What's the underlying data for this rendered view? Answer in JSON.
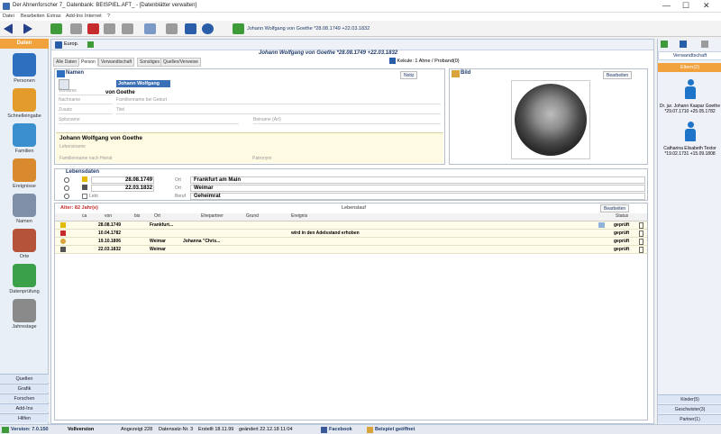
{
  "window": {
    "title": "Der Ahnenforscher 7_ Datenbank: BEISPIEL.AFT_ - [Datenblätter verwalten]",
    "controls": [
      "—",
      "☐",
      "✕"
    ]
  },
  "menu": [
    "Datei",
    "Bearbeiten",
    "Extras",
    "Add-Ins",
    "Internet",
    "?"
  ],
  "subbar": {
    "dropdown": "Europ."
  },
  "person_header": "Johann Wolfgang von Goethe   *28.08.1749  +22.03.1832",
  "kekule": "Kekule: 1  Ahne / Proband(0)",
  "tabs": [
    "Alle Daten",
    "Person",
    "Verwandtschaft",
    "Sonstiges",
    "Quellen/Verweise"
  ],
  "left_panel": {
    "header": "Daten",
    "nav": [
      "Personen",
      "Schnelleingabe",
      "Familien",
      "Ereignisse",
      "Namen",
      "Orte",
      "Datenprüfung",
      "Jahrestage"
    ],
    "bottom": [
      "Quellen",
      "Grafik",
      "Forschen",
      "Add-Ins",
      "Hilfen"
    ]
  },
  "names_box": {
    "title": "Namen",
    "notes_btn": "Notiz",
    "rufname": "Johann Wolfgang",
    "praefix": "von",
    "nachname": "Goethe",
    "placeholders": {
      "vorname": "Vorname",
      "nachname": "Nachname",
      "zusatz": "Familienname bei Geburt",
      "zusatz2": "Zusatz",
      "titel": "Titel",
      "spitz": "Spitzname",
      "beiname": "Beiname (Art)"
    },
    "full_name": "Johann Wolfgang von Goethe",
    "lebensname": "Lebensname",
    "famname_heirat": "Familienname nach Heirat",
    "patronym": "Patronym"
  },
  "bild_box": {
    "title": "Bild",
    "edit_btn": "Bearbeiten"
  },
  "lebensdaten": {
    "title": "Lebensdaten",
    "birth_date": "28.08.1749",
    "birth_place": "Frankfurt am Main",
    "death_date": "22.03.1832",
    "death_place": "Weimar",
    "beruf_label": "Beruf",
    "beruf": "Geheimrat",
    "ort_label": "Ort",
    "lebt_label": "Lebt"
  },
  "lebenslauf": {
    "alter": "Alter: 82 Jahr(e)",
    "title": "Lebenslauf",
    "edit_btn": "Bearbeiten",
    "columns": [
      "ca",
      "von",
      "bis",
      "Ort",
      "Ehepartner",
      "Grund",
      "Ereignis",
      "Status"
    ],
    "rows": [
      {
        "von": "28.08.1749",
        "ort": "Frankfurt...",
        "partner": "",
        "ereignis": "",
        "status": "geprüft"
      },
      {
        "von": "10.04.1782",
        "ort": "",
        "partner": "",
        "ereignis": "wird in den Adelsstand erhoben",
        "status": "geprüft"
      },
      {
        "von": "19.10.1806",
        "ort": "Weimar",
        "partner": "Johanna \"Chris...",
        "ereignis": "",
        "status": "geprüft"
      },
      {
        "von": "22.03.1832",
        "ort": "Weimar",
        "partner": "",
        "ereignis": "",
        "status": "geprüft"
      }
    ]
  },
  "right_panel": {
    "top_link": "Verwandtschaft",
    "eltern_header": "Eltern(2)",
    "father": "Dr. jur. Johann Kaspar Goethe\n*29.07.1710 +25.05.1782",
    "mother": "Catharina Elisabeth Textor\n*19.02.1731 +15.09.1808",
    "bottom": [
      "Kinder(5)",
      "Geschwister(3)",
      "Partner(1)"
    ]
  },
  "status": {
    "version": "Version: 7.0.150",
    "vollversion": "Vollversion",
    "angezeigt": "Angezeigt 228",
    "datensatz": "Datensatz-Nr. 3",
    "erstellt": "Erstellt 18.11.99",
    "geaendert": "geändert 22.12.18 11:04",
    "facebook": "Facebook",
    "beispiel": "Beispiel geöffnet"
  }
}
